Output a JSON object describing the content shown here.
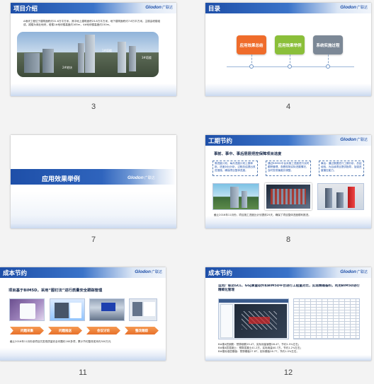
{
  "brand": {
    "name": "Glodon",
    "cn": "广联达"
  },
  "slides": [
    {
      "number": "3",
      "title": "项目介绍",
      "body": "A地块工程位于建筑面积约31.6万平方米，其中地上建筑面积23.8万平方米，地下建筑面积约7.8万平方米。主楼由塔楼组成，裙楼为商业地块，塔楼1#地块楼高度约165m，4#地块楼高度约150m。",
      "labels": [
        "1#塔楼",
        "3#塔楼",
        "2#地块"
      ]
    },
    {
      "number": "4",
      "title": "目录",
      "items": [
        {
          "label": "应用效果总结",
          "color": "#ef6c2b"
        },
        {
          "label": "应用效果举例",
          "color": "#8bbf3a"
        },
        {
          "label": "系统实施过程",
          "color": "#7c8896"
        }
      ]
    },
    {
      "number": "7",
      "title": "应用效果举例"
    },
    {
      "number": "8",
      "title": "工期节约",
      "subtitle": "事前、事中、事后层层把控保障项目进度",
      "boxes": [
        "周进度计划，每月进度计划上报审批，进度对比分析，过程总结提出改进措施，确保项目整体进度。",
        "通过BIM5D平台对施工进度进行实时跟踪管理，查看现场实际进展情况，及时发现偏差并调整。",
        "事后：通过数据进行工期分析，总结经验，为后续项目提供指导，加强进度管控能力。"
      ],
      "footer": "截止2016年11月份，项目施工进度比计划提前25天，确保了项目整体进度顺利推进。"
    },
    {
      "number": "11",
      "title": "成本节约",
      "subtitle": "项目基于BIM5D，采用“图钉法”进行质量安全跟踪管理",
      "steps": [
        "问题采集",
        "问题推送",
        "会议讨论",
        "整改跟踪"
      ],
      "footer": "截止2016年11月份该项目共发现质量安全问题约160多项，累计节约整改成本约300万元"
    },
    {
      "number": "12",
      "title": "成本节约",
      "subtitle": "运用广联达GCL、GGJ算量软件和BIM5D平台进行工程量对比，实现精确备料，利用BIM5D进行精细化管理",
      "lines": [
        "B#楼4层钢筋：预算钢筋29.4T，实际用量钢筋28.4T，节约1.5%左右；",
        "B#楼4层混凝土：预算混凝土41.2方，实际用量40.7方，节约1.2%左右；",
        "B#楼标准层模板：预算模板27.8T，实际模板26.7T，节约1.0%左右。"
      ]
    }
  ]
}
